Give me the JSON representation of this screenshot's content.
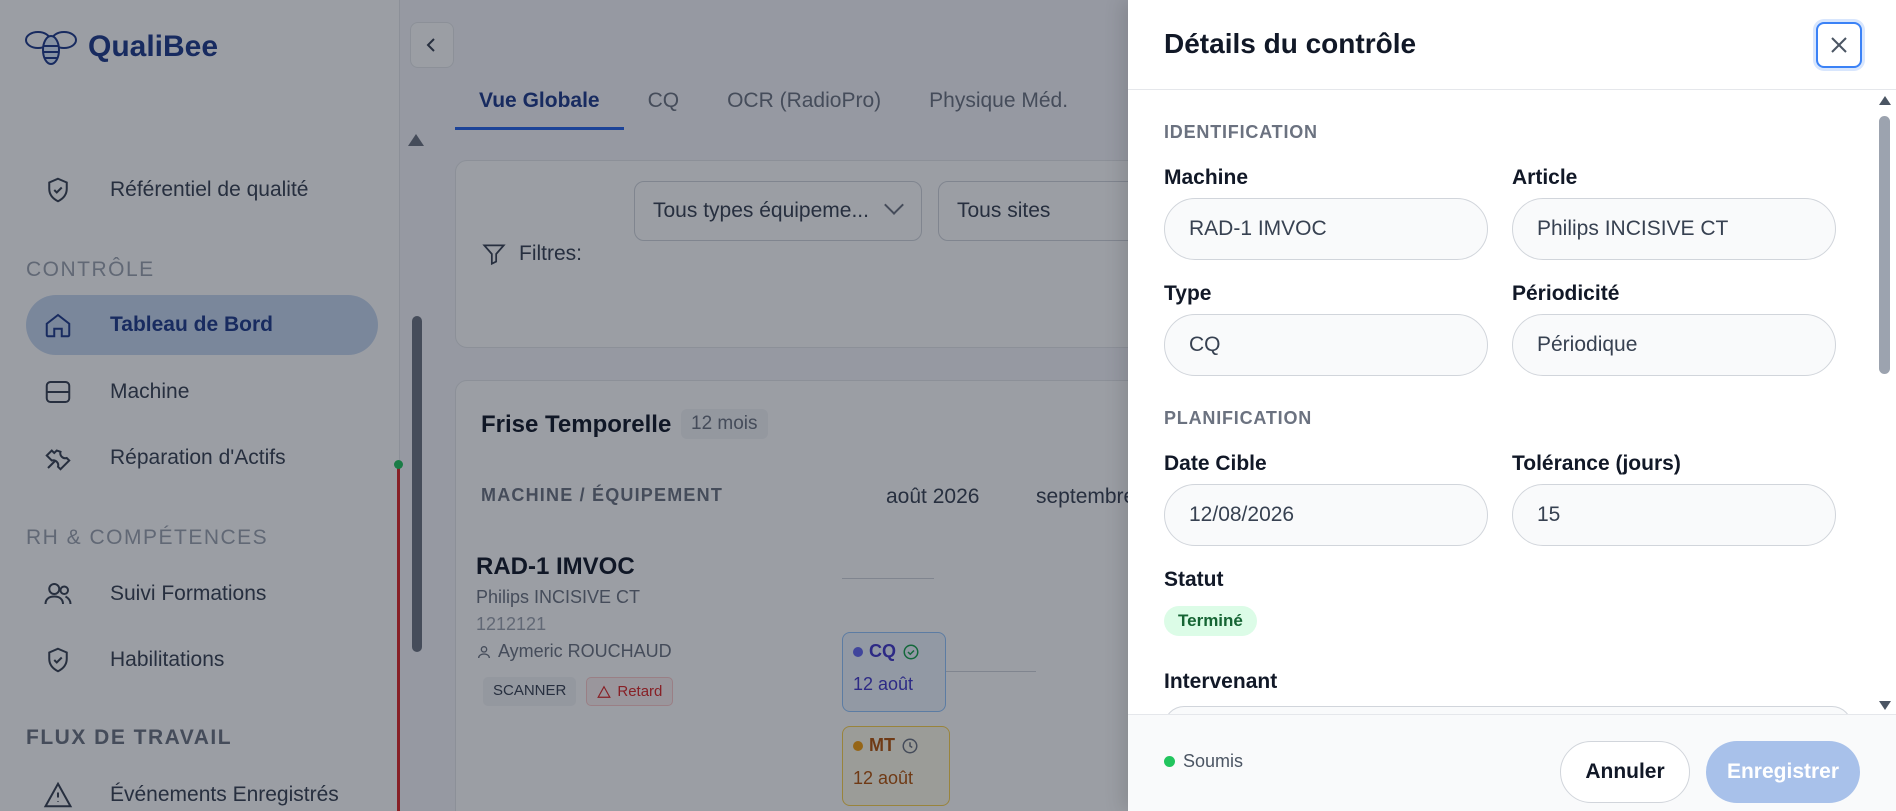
{
  "app": {
    "name": "QualiBee"
  },
  "sidebar": {
    "items_top": [
      {
        "label": "Référentiel de qualité",
        "icon": "shield-check-icon"
      }
    ],
    "section_controle": "CONTRÔLE",
    "items_controle": [
      {
        "label": "Tableau de Bord",
        "icon": "home-icon",
        "active": true
      },
      {
        "label": "Machine",
        "icon": "server-icon"
      },
      {
        "label": "Réparation d'Actifs",
        "icon": "wrench-icon"
      }
    ],
    "section_rh": "RH & COMPÉTENCES",
    "items_rh": [
      {
        "label": "Suivi Formations",
        "icon": "users-icon"
      },
      {
        "label": "Habilitations",
        "icon": "shield-check-icon"
      }
    ],
    "section_flux": "FLUX DE TRAVAIL",
    "items_flux": [
      {
        "label": "Événements Enregistrés",
        "icon": "warning-icon"
      }
    ]
  },
  "main": {
    "tabs": [
      "Vue Globale",
      "CQ",
      "OCR (RadioPro)",
      "Physique Méd."
    ],
    "filters": {
      "label": "Filtres:",
      "type_select": "Tous types équipeme...",
      "site_select": "Tous sites"
    },
    "timeline": {
      "title": "Frise Temporelle",
      "badge": "12 mois",
      "column_header": "MACHINE / ÉQUIPEMENT",
      "months": [
        "août 2026",
        "septembre"
      ],
      "machine": {
        "name": "RAD-1 IMVOC",
        "model": "Philips INCISIVE CT",
        "serial": "1212121",
        "person": "Aymeric ROUCHAUD",
        "tag_type": "SCANNER",
        "tag_late": "Retard"
      },
      "events": [
        {
          "code": "CQ",
          "date": "12 août"
        },
        {
          "code": "MT",
          "date": "12 août"
        }
      ]
    }
  },
  "drawer": {
    "title": "Détails du contrôle",
    "identification": {
      "heading": "IDENTIFICATION",
      "machine_label": "Machine",
      "machine_value": "RAD-1 IMVOC",
      "article_label": "Article",
      "article_value": "Philips INCISIVE CT",
      "type_label": "Type",
      "type_value": "CQ",
      "periodicite_label": "Périodicité",
      "periodicite_value": "Périodique"
    },
    "planification": {
      "heading": "PLANIFICATION",
      "date_label": "Date Cible",
      "date_value": "12/08/2026",
      "tolerance_label": "Tolérance (jours)",
      "tolerance_value": "15"
    },
    "statut_label": "Statut",
    "statut_value": "Terminé",
    "intervenant_label": "Intervenant",
    "footer": {
      "status": "Soumis",
      "cancel": "Annuler",
      "save": "Enregistrer"
    }
  },
  "colors": {
    "accent": "#2563eb",
    "active_nav_bg": "#c7d8f0",
    "status_done_bg": "#dcfce7",
    "status_done_text": "#166534",
    "save_button_bg": "#a8c1ea"
  }
}
